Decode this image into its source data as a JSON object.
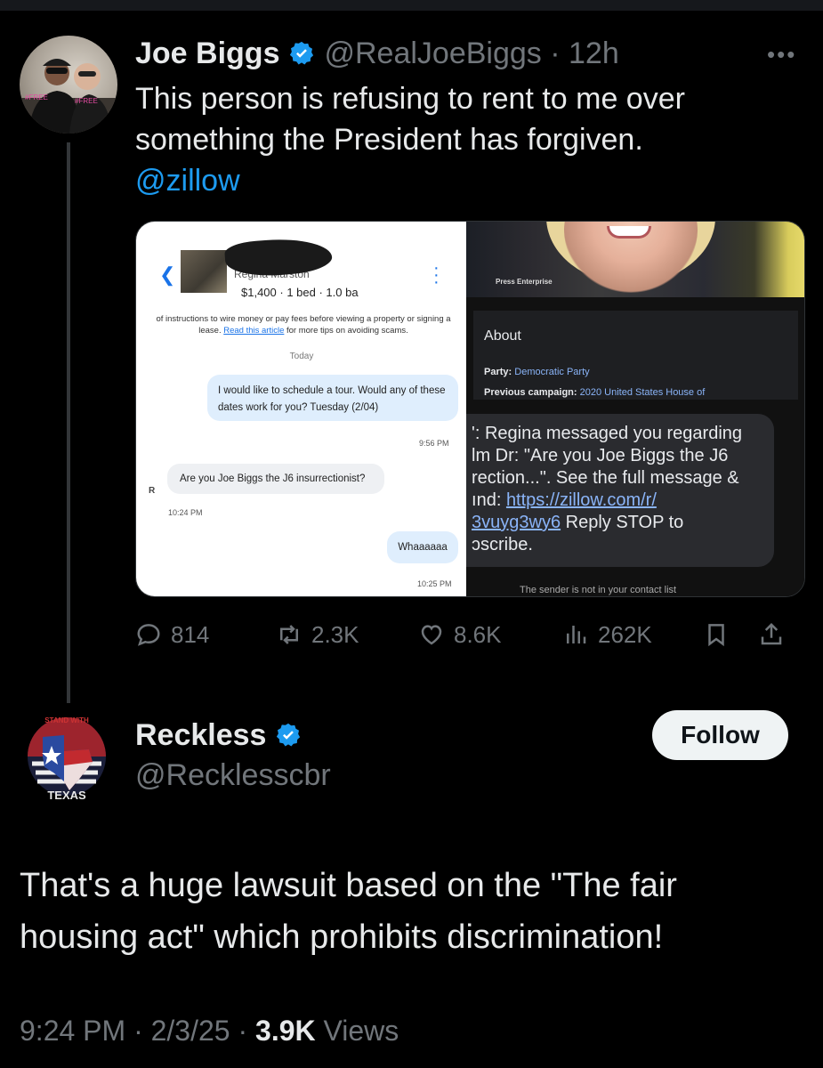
{
  "tweet": {
    "author_name": "Joe Biggs",
    "handle": "@RealJoeBiggs",
    "time": "· 12h",
    "text": "This person is refusing to rent to me over something the President has forgiven.",
    "mention": "@zillow",
    "media": {
      "zillow_chat": {
        "contact_name": "Regina Marston",
        "listing": "$1,400 · 1 bed · 1.0 ba",
        "scam_notice": "of instructions to wire money or pay fees before viewing a property or signing a lease.",
        "scam_link": "Read this article",
        "scam_tail": "for more tips on avoiding scams.",
        "date_divider": "Today",
        "msg1": "I would like to schedule a tour. Would any of these dates work for you? Tuesday (2/04)",
        "msg1_time": "9:56 PM",
        "msg2": "Are you Joe Biggs the J6 insurrectionist?",
        "msg2_sender_initial": "R",
        "msg2_time": "10:24 PM",
        "msg3": "Whaaaaaa",
        "msg3_time": "10:25 PM"
      },
      "google_panel": {
        "photo_credit": "Press Enterprise",
        "about_title": "About",
        "party_label": "Party:",
        "party_value": "Democratic Party",
        "prev_label": "Previous campaign:",
        "prev_value": "2020 United States House of"
      },
      "sms": {
        "line1": "': Regina messaged you regarding",
        "line2": "lm Dr: \"Are you Joe Biggs the J6",
        "line3": "rection...\". See the full message &",
        "line4_prefix": "ınd: ",
        "line4_link": "https://zillow.com/r/",
        "line5_link": "3vuyg3wy6",
        "line5_suffix": " Reply STOP to",
        "line6": "ɔscribe.",
        "sender_note": "The sender is not in your contact list"
      }
    },
    "stats": {
      "replies": "814",
      "reposts": "2.3K",
      "likes": "8.6K",
      "views": "262K"
    }
  },
  "reply": {
    "author_name": "Reckless",
    "handle": "@Recklesscbr",
    "follow_label": "Follow",
    "avatar_text_top": "STAND WITH",
    "avatar_text_bottom": "TEXAS",
    "text": "That's a huge lawsuit based on the \"The fair housing act\" which prohibits discrimination!",
    "time": "9:24 PM · 2/3/25 · ",
    "views_count": "3.9K",
    "views_label": " Views"
  },
  "colors": {
    "background": "#000000",
    "accent_blue": "#1d9bf0",
    "muted": "#71767b",
    "text": "#e7e9ea"
  }
}
